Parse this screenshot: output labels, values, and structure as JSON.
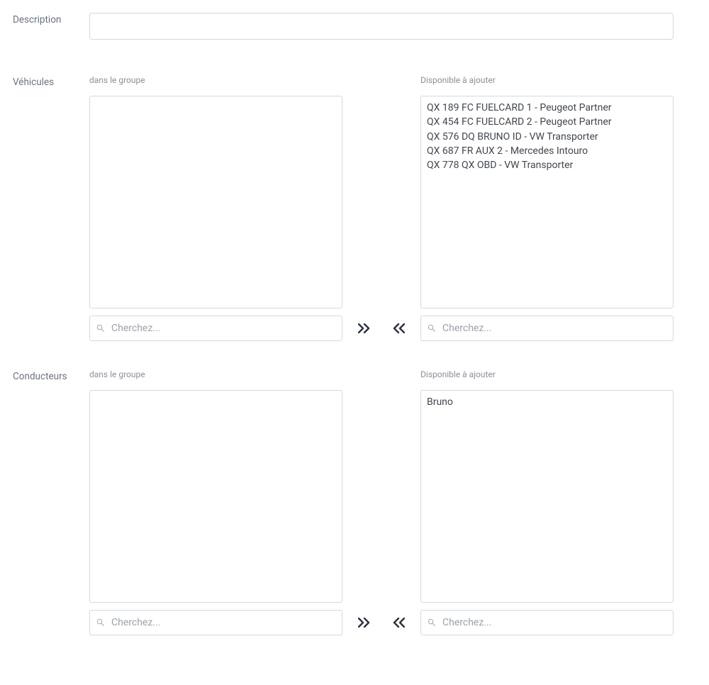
{
  "labels": {
    "description": "Description",
    "vehicles": "Véhicules",
    "drivers": "Conducteurs"
  },
  "sublabels": {
    "in_group": "dans le groupe",
    "available": "Disponible à ajouter"
  },
  "description": {
    "value": ""
  },
  "search": {
    "placeholder": "Cherchez..."
  },
  "vehicles": {
    "in_group": [],
    "available": [
      "QX 189 FC FUELCARD 1 - Peugeot Partner",
      "QX 454 FC FUELCARD 2 - Peugeot Partner",
      "QX 576 DQ BRUNO ID - VW Transporter",
      "QX 687 FR AUX 2 - Mercedes Intouro",
      "QX 778 QX OBD - VW Transporter"
    ]
  },
  "drivers": {
    "in_group": [],
    "available": [
      "Bruno"
    ]
  }
}
